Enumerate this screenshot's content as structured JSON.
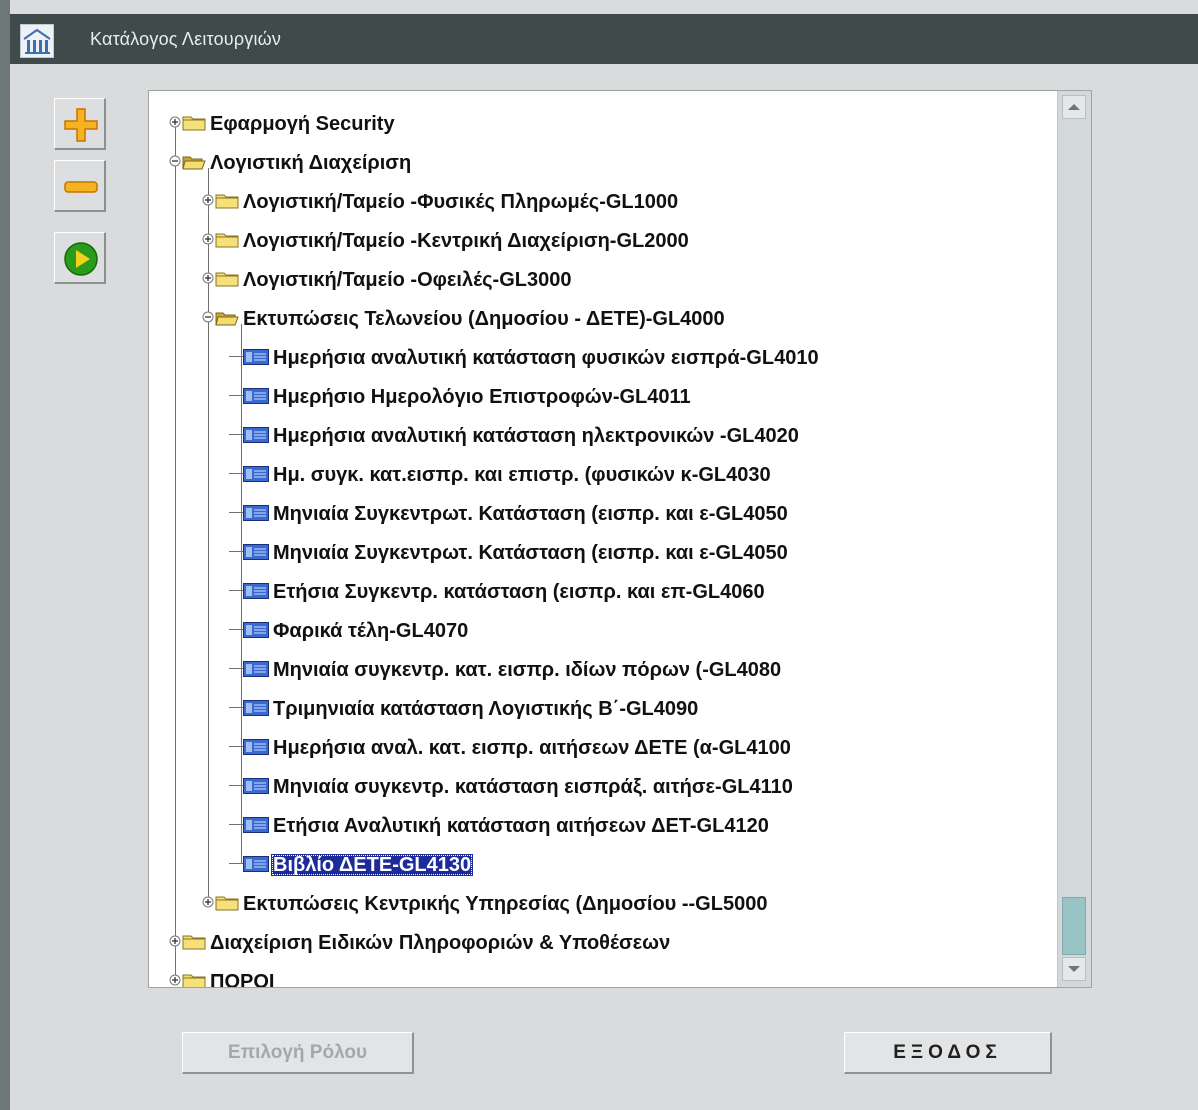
{
  "window": {
    "title": "Κατάλογος Λειτουργιών"
  },
  "toolbar": {
    "expand_icon": "plus-icon",
    "collapse_icon": "minus-icon",
    "run_icon": "play-icon",
    "colors": {
      "expand": "#f2a100",
      "collapse": "#f2a100",
      "run": "#2b9b1b"
    }
  },
  "tree": {
    "selected": "Βιβλίο ΔΕΤΕ-GL4130",
    "colors": {
      "selection_bg": "#1d2a9a",
      "selection_fg": "#ffffff",
      "folder": "#f2d65a"
    },
    "nodes": [
      {
        "label": "Εφαρμογή Security",
        "type": "folder",
        "state": "collapsed"
      },
      {
        "label": "Λογιστική Διαχείριση",
        "type": "folder",
        "state": "expanded"
      },
      {
        "label": "Λογιστική/Ταμείο -Φυσικές Πληρωμές-GL1000",
        "type": "folder",
        "state": "collapsed"
      },
      {
        "label": "Λογιστική/Ταμείο -Κεντρική Διαχείριση-GL2000",
        "type": "folder",
        "state": "collapsed"
      },
      {
        "label": "Λογιστική/Ταμείο -Οφειλές-GL3000",
        "type": "folder",
        "state": "collapsed"
      },
      {
        "label": "Εκτυπώσεις  Τελωνείου (Δημοσίου - ΔΕΤΕ)-GL4000",
        "type": "folder",
        "state": "expanded"
      },
      {
        "label": "Ημερήσια αναλυτική κατάσταση φυσικών εισπρά-GL4010",
        "type": "leaf"
      },
      {
        "label": "Ημερήσιο Ημερολόγιο Επιστροφών-GL4011",
        "type": "leaf"
      },
      {
        "label": "Ημερήσια αναλυτική κατάσταση ηλεκτρονικών  -GL4020",
        "type": "leaf"
      },
      {
        "label": "Ημ. συγκ. κατ.εισπρ. και επιστρ. (φυσικών κ-GL4030",
        "type": "leaf"
      },
      {
        "label": "Μηνιαία Συγκεντρωτ. Κατάσταση (εισπρ. και ε-GL4050",
        "type": "leaf"
      },
      {
        "label": "Μηνιαία Συγκεντρωτ. Κατάσταση (εισπρ. και ε-GL4050",
        "type": "leaf"
      },
      {
        "label": "Ετήσια Συγκεντρ. κατάσταση (εισπρ. και επ-GL4060",
        "type": "leaf"
      },
      {
        "label": "Φαρικά τέλη-GL4070",
        "type": "leaf"
      },
      {
        "label": "Μηνιαία συγκεντρ. κατ. εισπρ. ιδίων πόρων (-GL4080",
        "type": "leaf"
      },
      {
        "label": "Τριμηνιαία κατάσταση Λογιστικής Β΄-GL4090",
        "type": "leaf"
      },
      {
        "label": "Ημερήσια αναλ. κατ. εισπρ. αιτήσεων ΔΕΤΕ (α-GL4100",
        "type": "leaf"
      },
      {
        "label": "Μηνιαία συγκεντρ. κατάσταση εισπράξ. αιτήσε-GL4110",
        "type": "leaf"
      },
      {
        "label": "Ετήσια Αναλυτική κατάσταση αιτήσεων ΔΕΤ-GL4120",
        "type": "leaf"
      },
      {
        "label": "Βιβλίο ΔΕΤΕ-GL4130",
        "type": "leaf"
      },
      {
        "label": "Εκτυπώσεις  Κεντρικής Υπηρεσίας (Δημοσίου --GL5000",
        "type": "folder",
        "state": "collapsed"
      },
      {
        "label": "Διαχείριση Ειδικών Πληροφοριών & Υποθέσεων",
        "type": "folder",
        "state": "collapsed"
      },
      {
        "label": "ΠΟΡΟΙ",
        "type": "folder",
        "state": "collapsed"
      }
    ]
  },
  "buttons": {
    "select_role": "Επιλογή Ρόλου",
    "exit": "ΕΞΟΔΟΣ"
  }
}
